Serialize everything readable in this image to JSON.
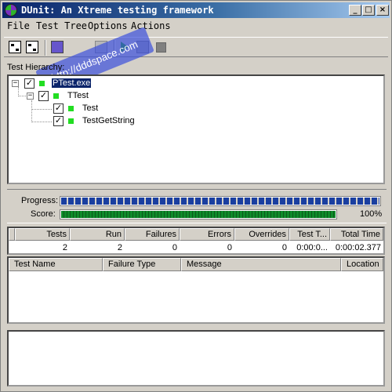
{
  "window": {
    "title": "DUnit: An Xtreme testing framework",
    "minimize_label": "_",
    "maximize_label": "□",
    "close_label": "×"
  },
  "menu": {
    "items": [
      "File",
      "Test Tree",
      "Options",
      "Actions"
    ]
  },
  "toolbar": {
    "icons": [
      "tree-select-icon",
      "tree-deselect-icon",
      "check-all-icon",
      "uncheck-icon",
      "run-icon",
      "run-step-icon",
      "stop-icon"
    ]
  },
  "watermark": {
    "text": "http://dddspace.com"
  },
  "tree": {
    "label": "Test Hierarchy:",
    "expand_symbol": "−",
    "check_symbol": "✓",
    "nodes": [
      {
        "label": "PTest.exe",
        "checked": true,
        "status": "passed",
        "selected": true
      },
      {
        "label": "TTest",
        "checked": true,
        "status": "passed"
      },
      {
        "label": "Test",
        "checked": true,
        "status": "passed"
      },
      {
        "label": "TestGetString",
        "checked": true,
        "status": "passed"
      }
    ],
    "status_color": "#22dd22"
  },
  "progress": {
    "progress_label": "Progress:",
    "score_label": "Score:",
    "progress_fraction": 1.0,
    "score_fraction": 1.0,
    "score_percent": "100%",
    "progress_color": "#1a3fa0",
    "score_color": "#0e8a2a"
  },
  "stats": {
    "columns": [
      "Tests",
      "Run",
      "Failures",
      "Errors",
      "Overrides",
      "Test T...",
      "Total Time"
    ],
    "values": [
      "2",
      "2",
      "0",
      "0",
      "0",
      "0:00:0...",
      "0:00:02.377"
    ]
  },
  "failures": {
    "columns": [
      "Test Name",
      "Failure Type",
      "Message",
      "Location"
    ],
    "rows": []
  }
}
